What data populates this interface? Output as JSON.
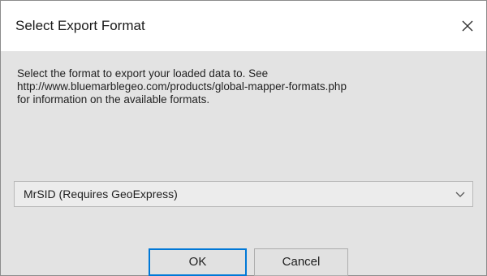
{
  "dialog": {
    "title": "Select Export Format",
    "close_icon": "close-icon",
    "description_lines": [
      "Select the format to export your loaded data to. See",
      "http://www.bluemarblegeo.com/products/global-mapper-formats.php",
      "for information on the available formats."
    ],
    "format_select": {
      "selected": "MrSID (Requires GeoExpress)",
      "icon": "chevron-down-icon"
    },
    "buttons": {
      "ok": "OK",
      "cancel": "Cancel"
    },
    "colors": {
      "accent": "#0078d7",
      "client_background": "#e3e3e3",
      "titlebar_background": "#ffffff"
    }
  }
}
